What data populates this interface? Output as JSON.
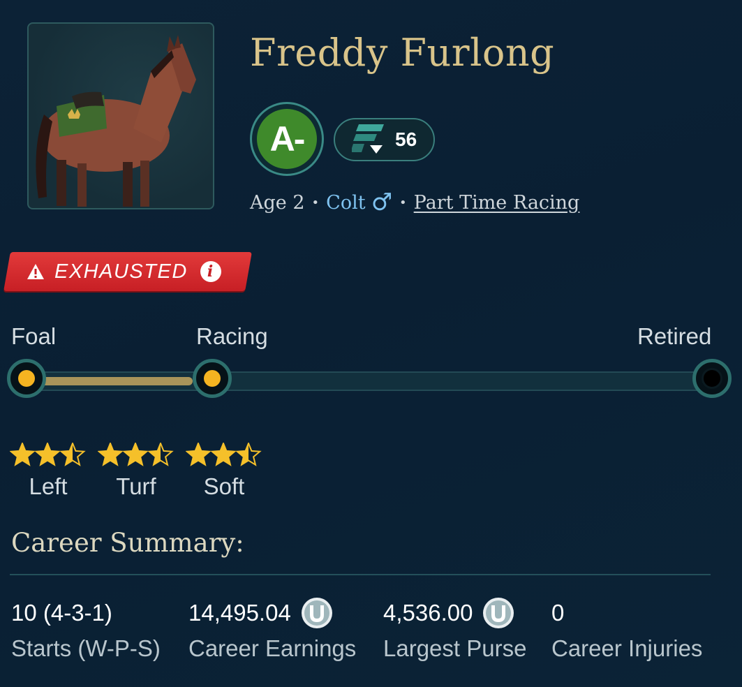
{
  "horse": {
    "name": "Freddy Furlong",
    "grade": "A-",
    "rating": "56",
    "age": "Age 2",
    "sex": "Colt",
    "sex_symbol": "♂",
    "racing_mode": "Part Time Racing"
  },
  "status_badge": {
    "label": "EXHAUSTED",
    "info_glyph": "i"
  },
  "stages": {
    "labels": [
      "Foal",
      "Racing",
      "Retired"
    ],
    "current": "Racing",
    "progress_percent": 27
  },
  "preferences": [
    {
      "label": "Left",
      "stars": 2.5,
      "max": 3
    },
    {
      "label": "Turf",
      "stars": 2.5,
      "max": 3
    },
    {
      "label": "Soft",
      "stars": 2.5,
      "max": 3
    }
  ],
  "career": {
    "title": "Career Summary:",
    "stats": [
      {
        "value": "10 (4-3-1)",
        "label": "Starts (W-P-S)",
        "icon": null
      },
      {
        "value": "14,495.04",
        "label": "Career Earnings",
        "icon": "horseshoe-coin-icon"
      },
      {
        "value": "4,536.00",
        "label": "Largest Purse",
        "icon": "horseshoe-coin-icon"
      },
      {
        "value": "0",
        "label": "Career Injuries",
        "icon": null
      }
    ]
  },
  "colors": {
    "name_gold": "#d9c48a",
    "grade_green": "#3f8a2b",
    "badge_red": "#d62b30",
    "track_fill": "#a8945a",
    "node_yellow": "#f5b421",
    "sex_blue": "#7fc3f0",
    "star_gold": "#f5c02a"
  }
}
